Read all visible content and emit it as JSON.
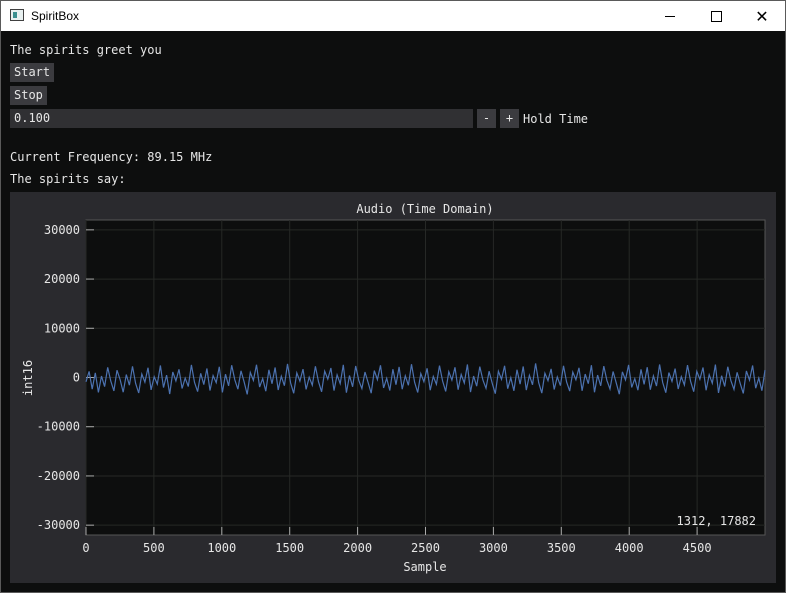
{
  "window": {
    "title": "SpiritBox"
  },
  "greeting": "The spirits greet you",
  "buttons": {
    "start": "Start",
    "stop": "Stop"
  },
  "hold_time": {
    "value": "0.100",
    "minus": "-",
    "plus": "+",
    "label": "Hold Time"
  },
  "frequency_line": "Current Frequency: 89.15 MHz",
  "spirits_say": "The spirits say:",
  "colors": {
    "line": "#4c72b0",
    "plot_bg": "#0d0e0e",
    "frame_bg": "#2a2a2e",
    "grid": "#262826"
  },
  "chart_data": {
    "type": "line",
    "title": "Audio (Time Domain)",
    "xlabel": "Sample",
    "ylabel": "int16",
    "xlim": [
      0,
      5000
    ],
    "ylim": [
      -32000,
      32000
    ],
    "x_ticks": [
      0,
      500,
      1000,
      1500,
      2000,
      2500,
      3000,
      3500,
      4000,
      4500
    ],
    "y_ticks": [
      30000,
      20000,
      10000,
      0,
      -10000,
      -20000,
      -30000
    ],
    "x_tick_labels": [
      "0",
      "500",
      "1000",
      "1500",
      "2000",
      "2500",
      "3000",
      "3500",
      "4000",
      "4500"
    ],
    "y_tick_labels": [
      "30000",
      "20000",
      "10000",
      "0",
      "-10000",
      "-20000",
      "-30000"
    ],
    "grid": true,
    "cursor_readout": "1312, 17882",
    "series": [
      {
        "values": [
          -880,
          1240,
          -2360,
          960,
          -3020,
          310,
          -1850,
          2060,
          -730,
          -2720,
          1480,
          -410,
          -2990,
          590,
          -1560,
          2280,
          -1180,
          -3140,
          720,
          -930,
          1990,
          -2510,
          160,
          -1340,
          2430,
          -2050,
          480,
          -3350,
          1120,
          -690,
          1670,
          -2240,
          -120,
          -1820,
          2560,
          -970,
          -2860,
          850,
          -1440,
          1830,
          -2650,
          390,
          -1030,
          2170,
          -3020,
          680,
          -1710,
          2490,
          -460,
          -2370,
          1360,
          -880,
          -3440,
          1020,
          -590,
          2610,
          -1940,
          -230,
          -2780,
          1570,
          -1280,
          2030,
          -2530,
          260,
          -1670,
          2760,
          -1090,
          -3210,
          930,
          -740,
          1710,
          -2420,
          60,
          -1570,
          2280,
          -860,
          -2910,
          1290,
          -330,
          1940,
          -2660,
          520,
          -1230,
          2590,
          -3090,
          410,
          -1880,
          2340,
          -610,
          -2260,
          1120,
          -1010,
          -3180,
          1410,
          -430,
          2480,
          -2110,
          -160,
          -2640,
          1690,
          -1460,
          2150,
          -2380,
          350,
          -1590,
          2700,
          -960,
          -3050,
          810,
          -860,
          1860,
          -2590,
          230,
          -1390,
          2420,
          -720,
          -2830,
          1180,
          -520,
          2070,
          -2470,
          610,
          -1120,
          2650,
          -2960,
          300,
          -1770,
          2210,
          -510,
          -2190,
          1280,
          -1150,
          -3290,
          1250,
          -370,
          2380,
          -2280,
          -50,
          -2710,
          1590,
          -1340,
          2240,
          -2550,
          450,
          -1480,
          2860,
          -1060,
          -3160,
          870,
          -640,
          1750,
          -2440,
          130,
          -1650,
          2370,
          -910,
          -2760,
          1090,
          -440,
          1980,
          -2700,
          700,
          -1260,
          2500,
          -3000,
          490,
          -1690,
          2320,
          -580,
          -2330,
          1210,
          -1070,
          -3400,
          1150,
          -480,
          2560,
          -2010,
          -250,
          -2580,
          1640,
          -1400,
          2100,
          -2480,
          330,
          -1750,
          2640,
          -1010,
          -3080,
          990,
          -800,
          1800,
          -2340,
          170,
          -1520,
          2520,
          -780,
          -2880,
          1260,
          -370,
          2030,
          -2600,
          560,
          -1180,
          2620,
          -3130,
          370,
          -1820,
          2190,
          -650,
          -2410,
          1060,
          -1200,
          -3230,
          1320,
          -530,
          2430,
          -2180,
          -110,
          -2690,
          1520
        ]
      }
    ]
  }
}
